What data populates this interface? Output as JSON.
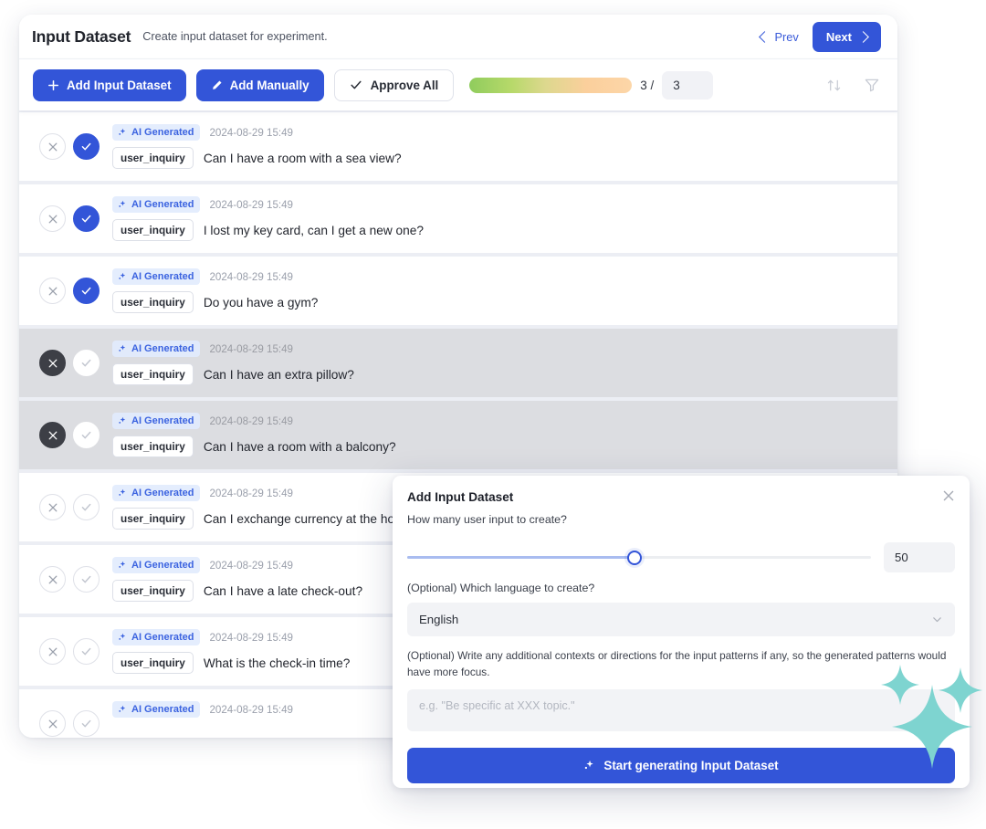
{
  "header": {
    "title": "Input Dataset",
    "subtitle": "Create input dataset for experiment.",
    "prev_label": "Prev",
    "next_label": "Next"
  },
  "toolbar": {
    "add_input_dataset_label": "Add Input Dataset",
    "add_manually_label": "Add Manually",
    "approve_all_label": "Approve All",
    "approved_count": "3 /",
    "total_value": "3",
    "sort_icon": "sort-icon",
    "filter_icon": "filter-icon"
  },
  "list": {
    "badge_label": "AI Generated",
    "tag_label": "user_inquiry",
    "rows": [
      {
        "timestamp": "2024-08-29 15:49",
        "text": "Can I have a room with a sea view?",
        "state": "approved"
      },
      {
        "timestamp": "2024-08-29 15:49",
        "text": "I lost my key card, can I get a new one?",
        "state": "approved"
      },
      {
        "timestamp": "2024-08-29 15:49",
        "text": "Do you have a gym?",
        "state": "approved"
      },
      {
        "timestamp": "2024-08-29 15:49",
        "text": "Can I have an extra pillow?",
        "state": "rejected"
      },
      {
        "timestamp": "2024-08-29 15:49",
        "text": "Can I have a room with a balcony?",
        "state": "rejected"
      },
      {
        "timestamp": "2024-08-29 15:49",
        "text": "Can I exchange currency at the hotel?",
        "state": "pending"
      },
      {
        "timestamp": "2024-08-29 15:49",
        "text": "Can I have a late check-out?",
        "state": "pending"
      },
      {
        "timestamp": "2024-08-29 15:49",
        "text": "What is the check-in time?",
        "state": "pending"
      },
      {
        "timestamp": "2024-08-29 15:49",
        "text": "",
        "state": "pending"
      }
    ]
  },
  "modal": {
    "title": "Add Input Dataset",
    "count_label": "How many user input to create?",
    "count_value": "50",
    "language_label": "(Optional) Which language to create?",
    "language_value": "English",
    "context_label": "(Optional) Write any additional contexts or directions for the input patterns if any, so the generated patterns would have more focus.",
    "context_placeholder": "e.g. \"Be specific at XXX topic.\"",
    "context_value": "",
    "generate_label": "Start generating Input Dataset",
    "close_icon": "close-icon"
  },
  "colors": {
    "accent": "#3355d8",
    "badge_bg": "#e4edfd",
    "badge_text": "#3b63e0",
    "rejected_row": "#dcdde1",
    "sparkle": "#7ed4d0",
    "progress_start": "#8fcc5d",
    "progress_end": "#fcd6a8"
  }
}
